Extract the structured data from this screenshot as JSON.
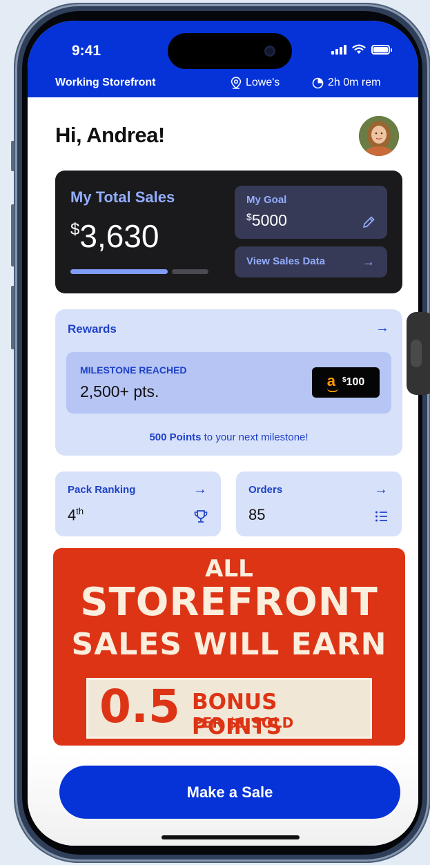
{
  "status_bar": {
    "time": "9:41"
  },
  "info_bar": {
    "mode": "Working Storefront",
    "location": "Lowe's",
    "remaining": "2h 0m rem"
  },
  "greeting": "Hi, Andrea!",
  "sales": {
    "title": "My Total Sales",
    "currency": "$",
    "amount": "3,630",
    "progress_fraction": 0.726,
    "goal_label": "My Goal",
    "goal_currency": "$",
    "goal_value": "5000",
    "view_label": "View Sales Data"
  },
  "rewards": {
    "title": "Rewards",
    "milestone_label": "MILESTONE REACHED",
    "milestone_points": "2,500+ pts.",
    "giftcard_brand": "a",
    "giftcard_currency": "$",
    "giftcard_value": "100",
    "next_points": "500 Points",
    "next_text": " to your next milestone!"
  },
  "pack_ranking": {
    "title": "Pack Ranking",
    "value": "4",
    "suffix": "th"
  },
  "orders": {
    "title": "Orders",
    "value": "85"
  },
  "promo": {
    "line1": "ALL",
    "line2": "STOREFRONT",
    "line3": "SALES WILL EARN",
    "number": "0.5",
    "bonus": "BONUS POINTS",
    "per": "PER $1 SOLD"
  },
  "make_sale_label": "Make a Sale",
  "colors": {
    "brand_blue": "#0533d8",
    "card_dark": "#1a1a1d",
    "accent_light": "#93adff",
    "panel_light": "#d8e1fa",
    "promo_red": "#dd3416"
  },
  "icons": [
    "location-pin-icon",
    "timer-icon",
    "pencil-icon",
    "arrow-right-icon",
    "trophy-icon",
    "list-icon",
    "signal-icon",
    "wifi-icon",
    "battery-icon"
  ]
}
